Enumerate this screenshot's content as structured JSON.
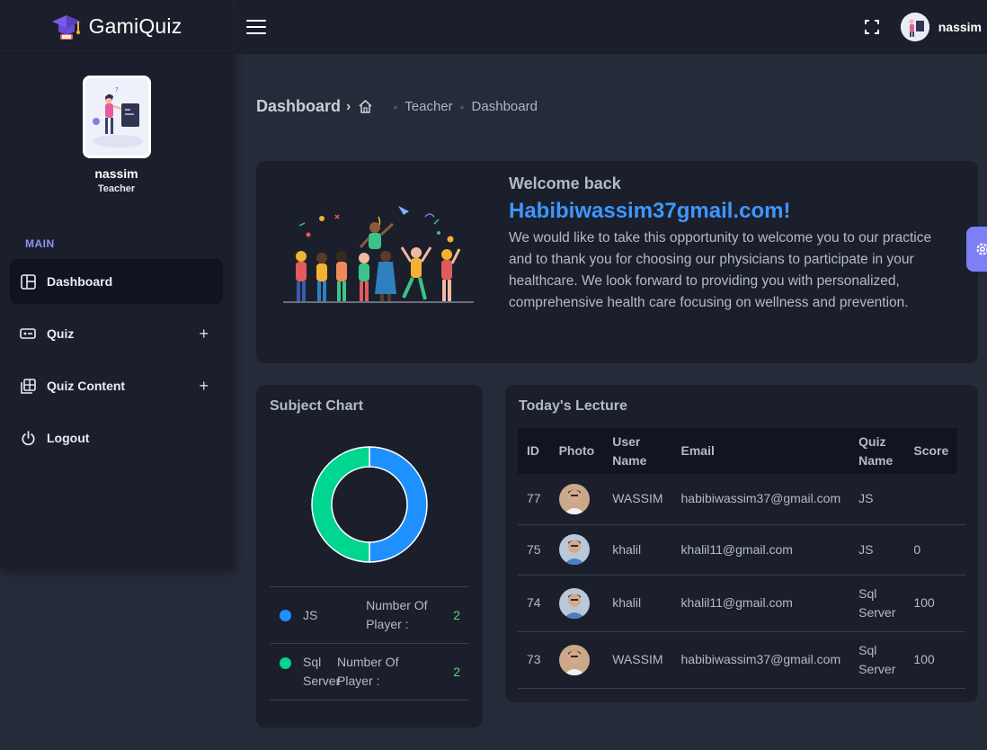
{
  "brand": {
    "name": "GamiQuiz"
  },
  "profile": {
    "name": "nassim",
    "role": "Teacher"
  },
  "sidebar": {
    "section_title": "MAIN",
    "items": [
      {
        "label": "Dashboard",
        "icon": "dashboard-icon"
      },
      {
        "label": "Quiz",
        "icon": "ticket-icon",
        "expand": "+"
      },
      {
        "label": "Quiz Content",
        "icon": "gallery-icon",
        "expand": "+"
      },
      {
        "label": "Logout",
        "icon": "power-icon"
      }
    ]
  },
  "topbar": {
    "user": "nassim"
  },
  "breadcrumb": {
    "title": "Dashboard",
    "items": [
      "Teacher",
      "Dashboard"
    ]
  },
  "welcome": {
    "subtitle": "Welcome back",
    "email": "Habibiwassim37gmail.com!",
    "body": "We would like to take this opportunity to welcome you to our practice and to thank you for choosing our physicians to participate in your healthcare. We look forward to providing you with personalized, comprehensive health care focusing on wellness and prevention."
  },
  "subject_chart": {
    "title": "Subject Chart",
    "legend_caption": "Number Of Player :"
  },
  "chart_data": {
    "type": "pie",
    "categories": [
      "JS",
      "Sql Server"
    ],
    "values": [
      2,
      2
    ],
    "colors": [
      "#1e90ff",
      "#00d68f"
    ],
    "donut": true
  },
  "lecture": {
    "title": "Today's Lecture",
    "columns": [
      "ID",
      "Photo",
      "User Name",
      "Email",
      "Quiz Name",
      "Score"
    ],
    "rows": [
      {
        "id": "77",
        "user": "WASSIM",
        "email": "habibiwassim37@gmail.com",
        "quiz": "JS",
        "score": ""
      },
      {
        "id": "75",
        "user": "khalil",
        "email": "khalil11@gmail.com",
        "quiz": "JS",
        "score": "0"
      },
      {
        "id": "74",
        "user": "khalil",
        "email": "khalil11@gmail.com",
        "quiz": "Sql Server",
        "score": "100"
      },
      {
        "id": "73",
        "user": "WASSIM",
        "email": "habibiwassim37@gmail.com",
        "quiz": "Sql Server",
        "score": "100"
      }
    ]
  }
}
